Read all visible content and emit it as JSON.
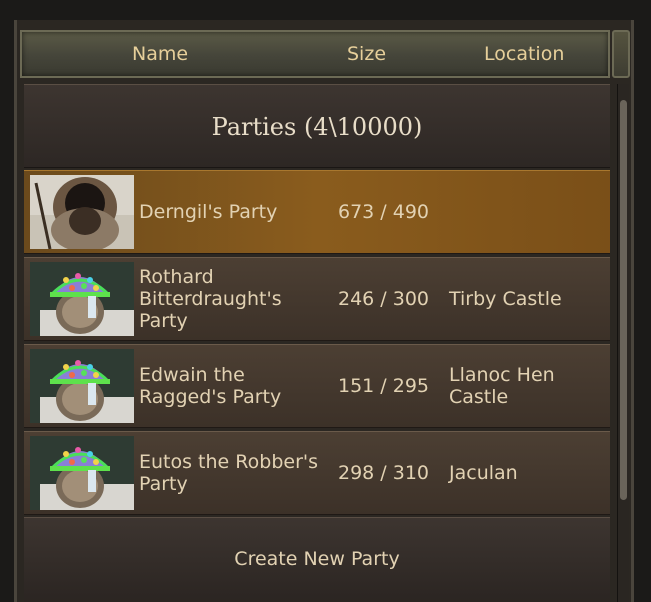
{
  "columns": {
    "name": "Name",
    "size": "Size",
    "location": "Location"
  },
  "title": "Parties (4\\10000)",
  "parties": [
    {
      "name": "Derngil's Party",
      "size": "673 / 490",
      "location": "",
      "selected": true,
      "portrait": "bearded-leader-portrait"
    },
    {
      "name": "Rothard Bitterdraught's Party",
      "size": "246 / 300",
      "location": "Tirby Castle",
      "selected": false,
      "portrait": "helmeted-warrior-portrait"
    },
    {
      "name": "Edwain the Ragged's Party",
      "size": "151 / 295",
      "location": "Llanoc Hen Castle",
      "selected": false,
      "portrait": "helmeted-warrior-portrait"
    },
    {
      "name": "Eutos the Robber's Party",
      "size": "298 / 310",
      "location": "Jaculan",
      "selected": false,
      "portrait": "helmeted-warrior-portrait"
    }
  ],
  "create_button": "Create New Party",
  "colors": {
    "header_text": "#e6cf9a",
    "row_text": "#e2d2b3",
    "selected_row": "#8a5c1d"
  }
}
